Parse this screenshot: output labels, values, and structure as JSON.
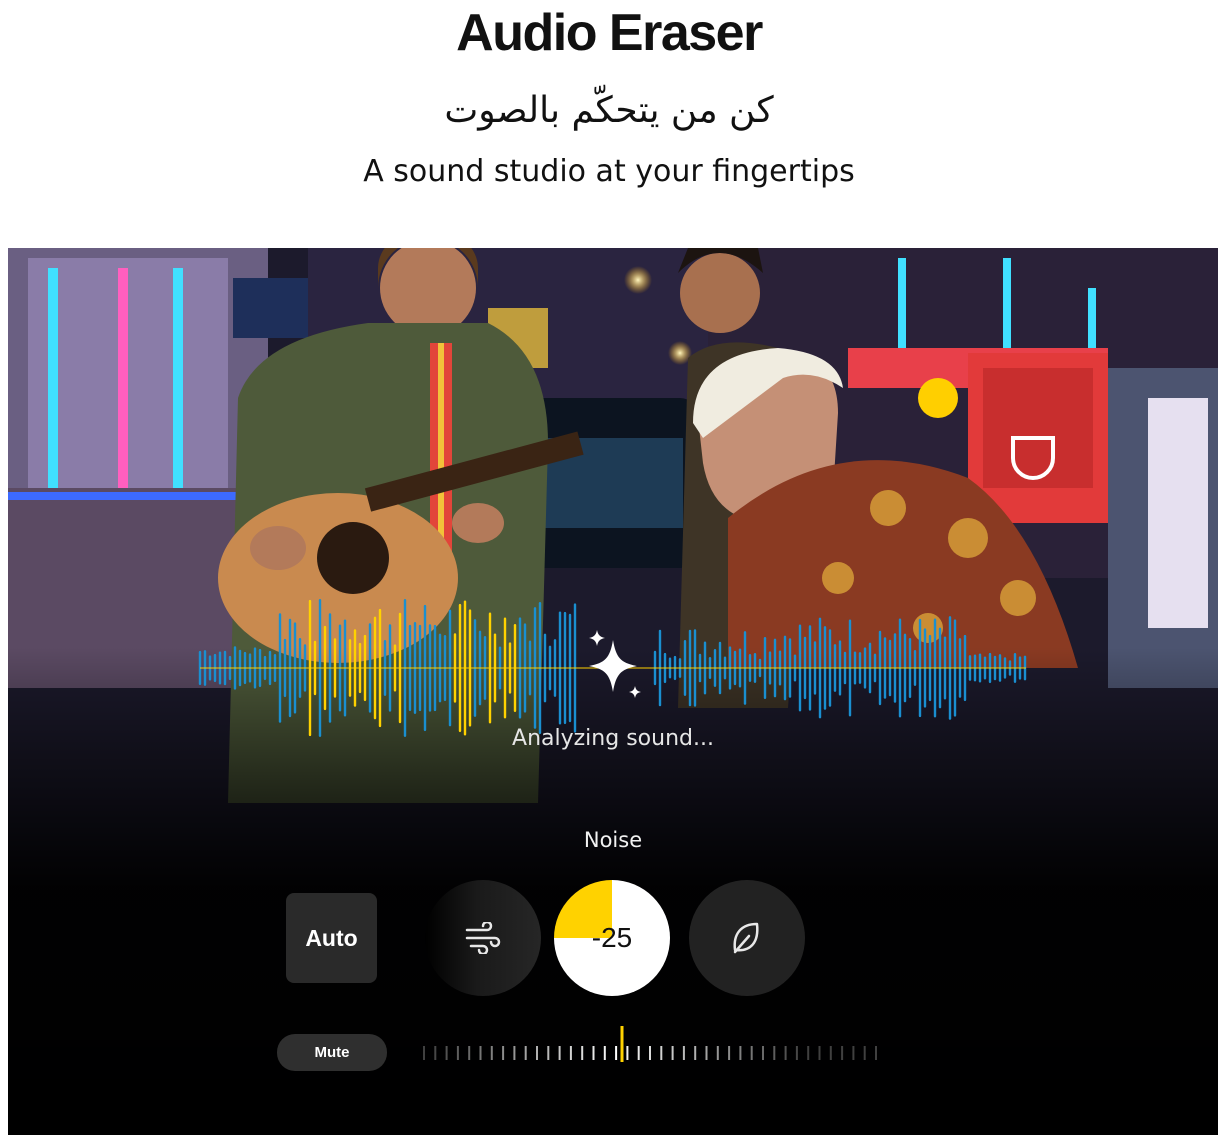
{
  "header": {
    "title": "Audio Eraser",
    "subtitle_ar": "كن من يتحكّم بالصوت",
    "subtitle_en": "A sound studio at your fingertips"
  },
  "player": {
    "status_text": "Analyzing sound...",
    "control_label": "Noise",
    "auto_label": "Auto",
    "noise_value": "-25",
    "noise_level_fraction": 0.25,
    "mute_label": "Mute",
    "wind_icon": "wind-icon",
    "nature_icon": "leaf-icon",
    "ai_icon": "sparkle-icon"
  },
  "colors": {
    "accent_yellow": "#ffd200",
    "wave_blue": "#1a8fd0",
    "panel_bg": "#000000"
  }
}
